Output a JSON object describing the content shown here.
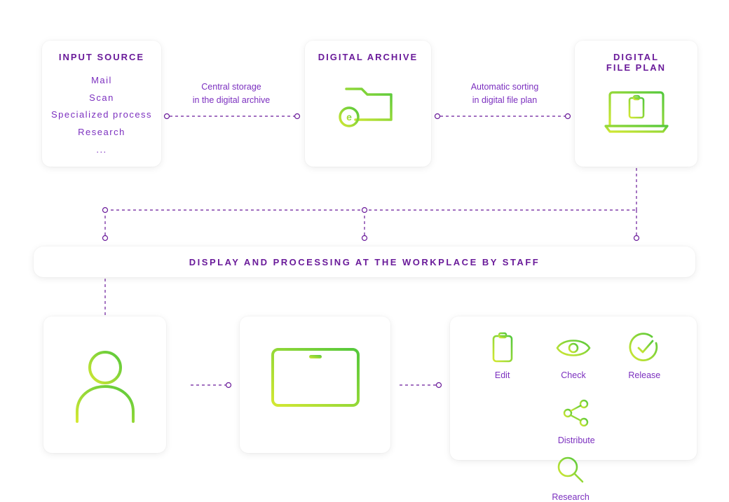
{
  "topCards": {
    "inputSource": {
      "title": "INPUT SOURCE",
      "items": [
        "Mail",
        "Scan",
        "Specialized process",
        "Research",
        "..."
      ]
    },
    "digitalArchive": {
      "title": "DIGITAL ARCHIVE"
    },
    "digitalFilePlan": {
      "title_l1": "DIGITAL",
      "title_l2": "FILE PLAN"
    }
  },
  "flowLabels": {
    "toArchive_l1": "Central storage",
    "toArchive_l2": "in the digital archive",
    "toFilePlan_l1": "Automatic sorting",
    "toFilePlan_l2": "in digital file plan"
  },
  "midBar": {
    "text": "DISPLAY AND PROCESSING AT THE WORKPLACE BY STAFF"
  },
  "actions": {
    "edit": "Edit",
    "check": "Check",
    "release": "Release",
    "distribute": "Distribute",
    "research": "Research"
  },
  "colors": {
    "purple": "#6a1b9a",
    "gradA": "#d4e833",
    "gradB": "#54c83c"
  }
}
